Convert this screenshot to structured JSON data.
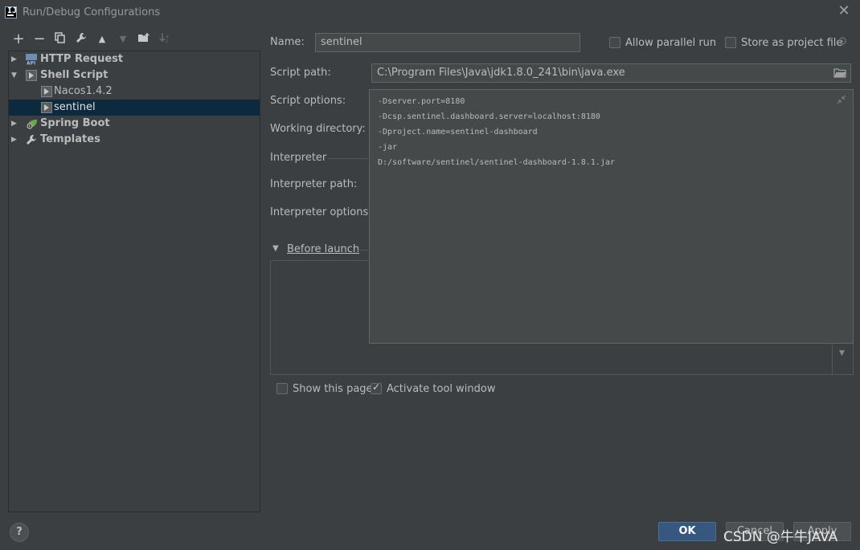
{
  "window": {
    "title": "Run/Debug Configurations"
  },
  "toolbar": {
    "add": "+",
    "remove": "−",
    "copy": "⧉",
    "edit": "🔧",
    "move_up": "▲",
    "move_down": "▼",
    "folder": "📁",
    "sort": "↓⃗"
  },
  "tree": {
    "items": [
      {
        "label": "HTTP Request",
        "icon": "api-icon"
      },
      {
        "label": "Shell Script",
        "icon": "shell-script-icon"
      },
      {
        "label": "Nacos1.4.2",
        "icon": "shell-script-icon"
      },
      {
        "label": "sentinel",
        "icon": "shell-script-icon"
      },
      {
        "label": "Spring Boot",
        "icon": "spring-boot-icon"
      },
      {
        "label": "Templates",
        "icon": "wrench-icon"
      }
    ]
  },
  "form": {
    "name_label": "Name:",
    "name_value": "sentinel",
    "allow_parallel_label": "Allow parallel run",
    "store_project_label": "Store as project file",
    "script_path_label": "Script path:",
    "script_path_value": "C:\\Program Files\\Java\\jdk1.8.0_241\\bin\\java.exe",
    "script_options_label": "Script options:",
    "working_dir_label": "Working directory:",
    "interpreter_label": "Interpreter",
    "interpreter_path_label": "Interpreter path:",
    "interpreter_options_label": "Interpreter options:",
    "before_launch_label": "Before launch",
    "show_page_label": "Show this page",
    "activate_tool_label": "Activate tool window",
    "script_options_lines": [
      "-Dserver.port=8180",
      "-Dcsp.sentinel.dashboard.server=localhost:8180",
      "-Dproject.name=sentinel-dashboard",
      "-jar",
      "D:/software/sentinel/sentinel-dashboard-1.8.1.jar"
    ]
  },
  "buttons": {
    "ok": "OK",
    "cancel": "Cancel",
    "apply": "Apply",
    "help": "?"
  },
  "watermark": "CSDN @牛牛JAVA"
}
